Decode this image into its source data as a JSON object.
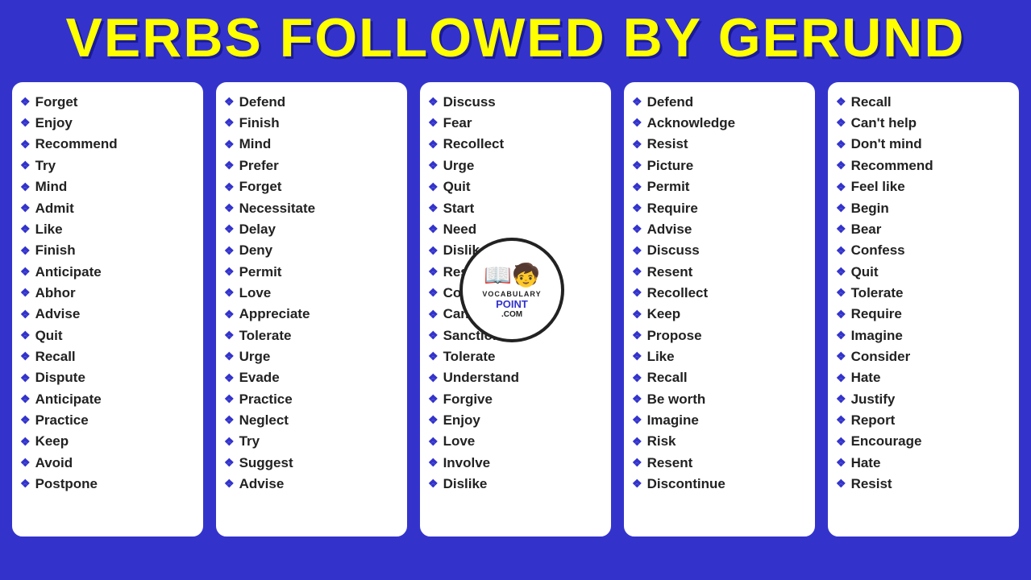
{
  "header": {
    "title": "VERBS FOLLOWED BY GERUND"
  },
  "columns": [
    {
      "id": "col1",
      "words": [
        "Forget",
        "Enjoy",
        "Recommend",
        "Try",
        "Mind",
        "Admit",
        "Like",
        "Finish",
        "Anticipate",
        "Abhor",
        "Advise",
        "Quit",
        "Recall",
        "Dispute",
        "Anticipate",
        "Practice",
        "Keep",
        "Avoid",
        "Postpone"
      ]
    },
    {
      "id": "col2",
      "words": [
        "Defend",
        "Finish",
        "Mind",
        "Prefer",
        "Forget",
        "Necessitate",
        "Delay",
        "Deny",
        "Permit",
        "Love",
        "Appreciate",
        "Tolerate",
        "Urge",
        "Evade",
        "Practice",
        "Neglect",
        "Try",
        "Suggest",
        "Advise"
      ]
    },
    {
      "id": "col3",
      "words": [
        "Discuss",
        "Fear",
        "Recollect",
        "Urge",
        "Quit",
        "Start",
        "Need",
        "Dislike",
        "Resume",
        "Complete",
        "Can't help",
        "Sanction",
        "Tolerate",
        "Understand",
        "Forgive",
        "Enjoy",
        "Love",
        "Involve",
        "Dislike"
      ]
    },
    {
      "id": "col4",
      "words": [
        "Defend",
        "Acknowledge",
        "Resist",
        "Picture",
        "Permit",
        "Require",
        "Advise",
        "Discuss",
        "Resent",
        "Recollect",
        "Keep",
        "Propose",
        "Like",
        "Recall",
        "Be worth",
        "Imagine",
        "Risk",
        "Resent",
        "Discontinue"
      ]
    },
    {
      "id": "col5",
      "words": [
        "Recall",
        "Can't help",
        "Don't mind",
        "Recommend",
        "Feel like",
        "Begin",
        "Bear",
        "Confess",
        "Quit",
        "Tolerate",
        "Require",
        "Imagine",
        "Consider",
        "Hate",
        "Justify",
        "Report",
        "Encourage",
        "Hate",
        "Resist"
      ]
    }
  ],
  "diamond": "❖",
  "logo": {
    "emoji": "📘",
    "character": "🧒",
    "line1": "VOCABULARY",
    "line2": "POINT",
    "line3": ".COM"
  }
}
